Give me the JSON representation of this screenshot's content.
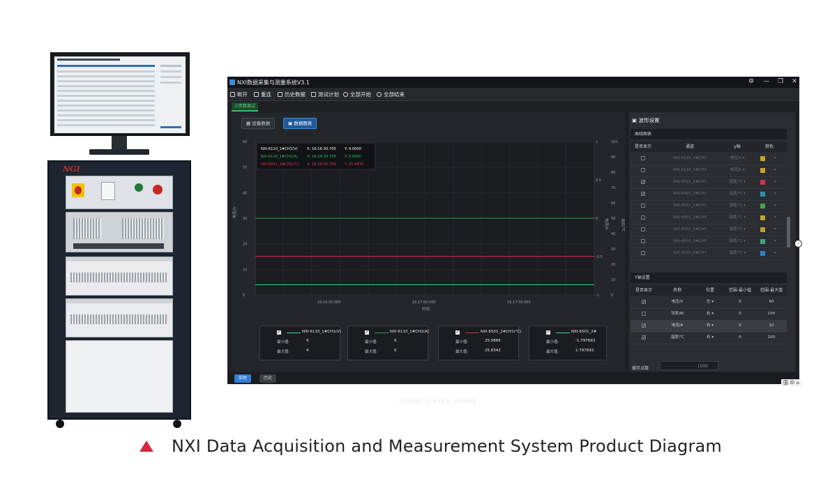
{
  "app": {
    "title": "NXI数据采集与测量系统V3.1",
    "window_controls": [
      "⚙",
      "—",
      "❐",
      "✕"
    ],
    "toolbar": [
      {
        "label": "断开",
        "icon": "link-icon"
      },
      {
        "label": "重连",
        "icon": "relink-icon"
      },
      {
        "label": "历史数据",
        "icon": "history-icon"
      },
      {
        "label": "测试计划",
        "icon": "calendar-icon"
      },
      {
        "label": "全部开始",
        "icon": "play-icon"
      },
      {
        "label": "全部结束",
        "icon": "stop-icon"
      }
    ],
    "tab": "三参数测试",
    "view_buttons": {
      "device": "设备数据",
      "chart": "数据图表"
    },
    "monitor_controls": {
      "start": "开始监视",
      "stop": "停止监视",
      "reset": "刷新配置"
    },
    "bottom_buttons": {
      "realtime": "实时",
      "history": "历史"
    }
  },
  "chart_data": {
    "type": "line",
    "x_ticks": [
      "16:16:30.000",
      "16:17:00.000",
      "16:17:30.000"
    ],
    "xlabel": "时间",
    "left_axis": {
      "label": "电压/V",
      "ticks": [
        0,
        10,
        20,
        30,
        40,
        50,
        60
      ],
      "range": [
        0,
        60
      ]
    },
    "right_axis_a": {
      "label": "电流/A",
      "ticks": [
        -1,
        -0.5,
        0,
        0.5,
        1
      ],
      "range": [
        -1,
        1
      ]
    },
    "right_axis_b": {
      "label": "温度/℃",
      "ticks": [
        0,
        10,
        20,
        30,
        40,
        50,
        60,
        70,
        80,
        90,
        100
      ],
      "range": [
        0,
        100
      ]
    },
    "series": [
      {
        "name": "NXI-6110_1#CH1(V)",
        "color": "#3ddc84",
        "value": 4,
        "axis": "left_axis"
      },
      {
        "name": "NXI-6110_1#CH2(A)",
        "color": "#2e9b4f",
        "value": 0,
        "axis": "right_axis_a"
      },
      {
        "name": "NXI-6501_2#CH1(℃)",
        "color": "#e0334a",
        "value": 25.0886,
        "axis": "right_axis_b"
      }
    ],
    "tooltip": [
      {
        "name": "NXI-6110_1#CH1(V)",
        "x": "X: 16:16:30.705",
        "y": "Y: 4.0000",
        "color": "#ffffff"
      },
      {
        "name": "NXI-6110_1#CH2(A)",
        "x": "X: 16:16:30.705",
        "y": "Y: 0.0000",
        "color": "#2fbf5b"
      },
      {
        "name": "NXI-6501_2#CH1(℃)",
        "x": "X: 16:16:30.705",
        "y": "Y: 25.4837",
        "color": "#e0334a"
      }
    ]
  },
  "legend_cards": [
    {
      "name": "NXI-6110_1#CH1(V)",
      "color": "#3ddc84",
      "min_label": "最小值:",
      "min": "4",
      "max_label": "最大值:",
      "max": "4"
    },
    {
      "name": "NXI-6110_1#CH2(A)",
      "color": "#2e9b4f",
      "min_label": "最小值:",
      "min": "0",
      "max_label": "最大值:",
      "max": "0"
    },
    {
      "name": "NXI-6501_2#CH1(℃)",
      "color": "#e0334a",
      "min_label": "最小值:",
      "min": "25.0886",
      "max_label": "最大值:",
      "max": "25.8342"
    },
    {
      "name": "NXI-6501_2#",
      "color": "#3ddc84",
      "min_label": "最小值:",
      "min": "-1.797693",
      "max_label": "最大值:",
      "max": "1.797693"
    }
  ],
  "settings": {
    "title": "波形设置",
    "curve_section": "曲线图表",
    "curve_headers": [
      "是否显示",
      "通道",
      "y轴",
      "颜色"
    ],
    "curves": [
      {
        "checked": false,
        "channel": "NXI-6110_1#CH1",
        "axis": "电压/V",
        "color": "#c9a227"
      },
      {
        "checked": false,
        "channel": "NXI-6110_1#CH2",
        "axis": "电流/A",
        "color": "#c9a227"
      },
      {
        "checked": true,
        "channel": "NXI-6501_2#CH1",
        "axis": "温度/℃",
        "color": "#d0354c"
      },
      {
        "checked": true,
        "channel": "NXI-6501_2#CH2",
        "axis": "温度/℃",
        "color": "#2e8fa8"
      },
      {
        "checked": false,
        "channel": "NXI-6501_2#CH3",
        "axis": "温度/℃",
        "color": "#3aa645"
      },
      {
        "checked": false,
        "channel": "NXI-6501_2#CH4",
        "axis": "温度/℃",
        "color": "#c9a227"
      },
      {
        "checked": false,
        "channel": "NXI-6501_2#CH5",
        "axis": "温度/℃",
        "color": "#b8a22a"
      },
      {
        "checked": false,
        "channel": "NXI-6501_2#CH6",
        "axis": "温度/℃",
        "color": "#3aa67a"
      },
      {
        "checked": false,
        "channel": "NXI-6501_2#CH7",
        "axis": "温度/℃",
        "color": "#2f7fd4"
      }
    ],
    "y_section": "Y轴设置",
    "y_headers": [
      "是否显示",
      "名称",
      "位置",
      "范围-最小值",
      "范围-最大值"
    ],
    "y_axes": [
      {
        "checked": true,
        "name": "电压/V",
        "position": "左",
        "min": "0",
        "max": "60"
      },
      {
        "checked": false,
        "name": "功率/W",
        "position": "右",
        "min": "0",
        "max": "100"
      },
      {
        "checked": true,
        "name": "电流/A",
        "position": "右",
        "min": "0",
        "max": "10"
      },
      {
        "checked": true,
        "name": "温度/℃",
        "position": "右",
        "min": "0",
        "max": "100"
      }
    ],
    "cache_label": "缓存点数",
    "cache_value": "1000"
  },
  "tray": "国 中 ⌂",
  "caption": "NXI Data Acquisition and Measurement System Product Diagram",
  "cabinet_logo": "NGI"
}
